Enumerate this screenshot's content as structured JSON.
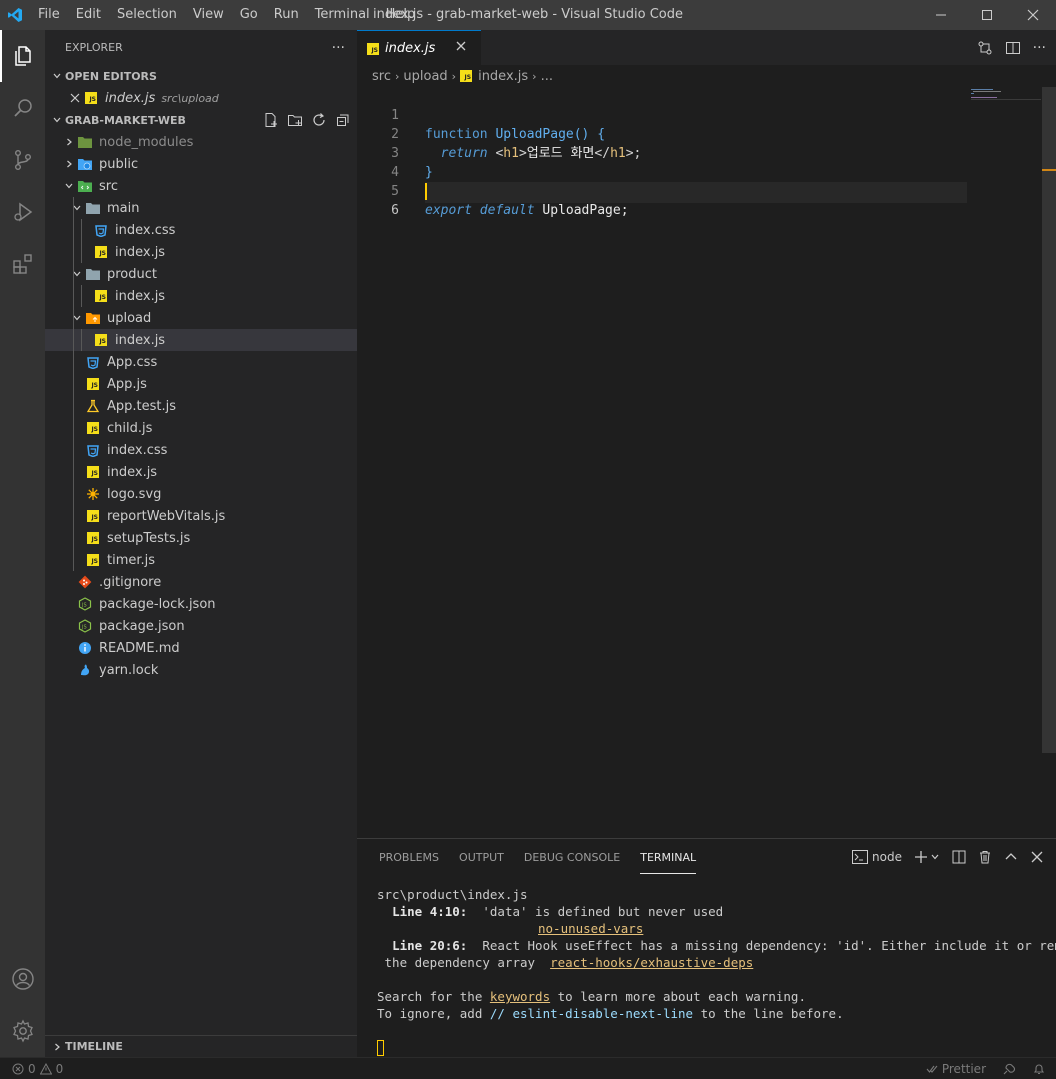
{
  "window": {
    "title": "index.js - grab-market-web - Visual Studio Code",
    "menu": [
      "File",
      "Edit",
      "Selection",
      "View",
      "Go",
      "Run",
      "Terminal",
      "Help"
    ]
  },
  "sidebar": {
    "title": "EXPLORER",
    "open_editors": {
      "header": "OPEN EDITORS",
      "items": [
        {
          "name": "index.js",
          "path": "src\\upload"
        }
      ]
    },
    "project": {
      "header": "GRAB-MARKET-WEB",
      "tree": [
        "node_modules",
        "public",
        "src",
        "main",
        "index.css",
        "index.js",
        "product",
        "index.js",
        "upload",
        "index.js",
        "App.css",
        "App.js",
        "App.test.js",
        "child.js",
        "index.css",
        "index.js",
        "logo.svg",
        "reportWebVitals.js",
        "setupTests.js",
        "timer.js",
        ".gitignore",
        "package-lock.json",
        "package.json",
        "README.md",
        "yarn.lock"
      ]
    },
    "timeline": "TIMELINE"
  },
  "editor": {
    "tab": "index.js",
    "breadcrumbs": [
      "src",
      "upload",
      "index.js",
      "..."
    ],
    "line_numbers": [
      "1",
      "2",
      "3",
      "4",
      "5",
      "6"
    ],
    "code": {
      "l1_kw": "function",
      "l1_fn": "UploadPage",
      "l1_rest": "() {",
      "l2_kw": "return",
      "l2_open_lt": "<",
      "l2_tag": "h1",
      "l2_gt": ">",
      "l2_text": "업로드 화면",
      "l2_close_lt": "</",
      "l2_tag2": "h1",
      "l2_end": ">;",
      "l3": "}",
      "l5_kw1": "export",
      "l5_kw2": "default",
      "l5_name": "UploadPage;"
    }
  },
  "panel": {
    "tabs": [
      "PROBLEMS",
      "OUTPUT",
      "DEBUG CONSOLE",
      "TERMINAL"
    ],
    "active_tab": "TERMINAL",
    "terminal_name": "node",
    "terminal": {
      "file": "src\\product\\index.js",
      "w1_loc": "Line 4:10:",
      "w1_msg": "  'data' is defined but never used",
      "w1_rule": "no-unused-vars",
      "w2_loc": "Line 20:6:",
      "w2_msg": "  React Hook useEffect has a missing dependency: 'id'. Either include it or remove",
      "w2_cont": " the dependency array  ",
      "w2_rule": "react-hooks/exhaustive-deps",
      "search_pre": "Search for the ",
      "search_link": "keywords",
      "search_post": " to learn more about each warning.",
      "ignore_pre": "To ignore, add ",
      "ignore_code": "// eslint-disable-next-line",
      "ignore_post": " to the line before."
    }
  },
  "status": {
    "errors": "0",
    "warnings": "0",
    "prettier": "Prettier"
  },
  "colors": {
    "accent": "#007acc",
    "js_icon": "#f5de19",
    "css_icon": "#42a5f5",
    "terminal_link": "#e5c07b"
  }
}
